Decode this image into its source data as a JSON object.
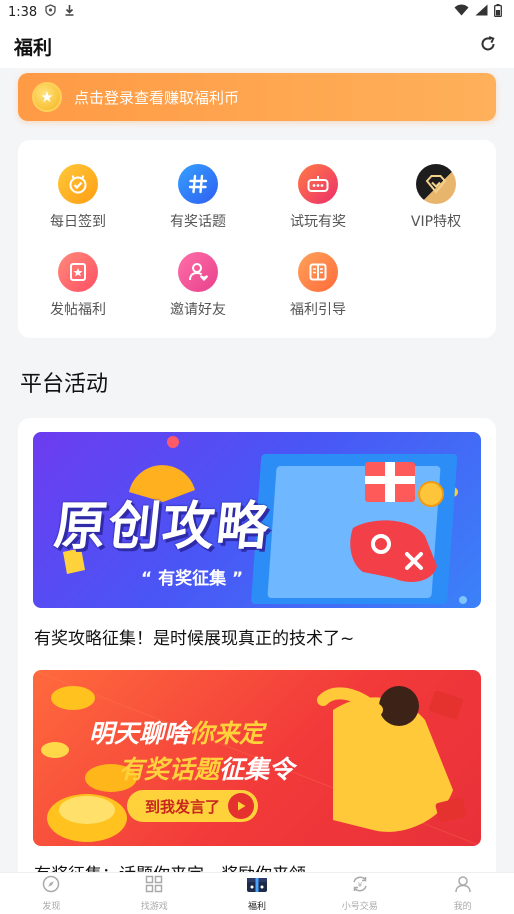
{
  "status": {
    "time": "1:38"
  },
  "header": {
    "title": "福利"
  },
  "login_banner": {
    "text": "点击登录查看赚取福利币"
  },
  "welfare_grid": [
    {
      "label": "每日签到",
      "icon": "checkin-icon",
      "color": "#ffb21d"
    },
    {
      "label": "有奖话题",
      "icon": "hashtag-icon",
      "color": "#2f7bf6"
    },
    {
      "label": "试玩有奖",
      "icon": "gamepad-icon",
      "color": "#f0525a"
    },
    {
      "label": "VIP特权",
      "icon": "vip-diamond-icon",
      "color": "#2b2b2b"
    },
    {
      "label": "发帖福利",
      "icon": "post-icon",
      "color": "#ff5d6a"
    },
    {
      "label": "邀请好友",
      "icon": "invite-friend-icon",
      "color": "#ff5b93"
    },
    {
      "label": "福利引导",
      "icon": "guide-book-icon",
      "color": "#ff7a3c"
    }
  ],
  "platform": {
    "section_title": "平台活动",
    "activities": [
      {
        "banner_title": "原创攻略",
        "banner_subtitle": "有奖征集",
        "caption": "有奖攻略征集！是时候展现真正的技术了~"
      },
      {
        "banner_line1_a": "明天聊啥",
        "banner_line1_b": "你来定",
        "banner_line2_a": "有奖话题",
        "banner_line2_b": "征集令",
        "banner_button": "到我发言了",
        "caption": "有奖征集：话题你来定，奖励你来领"
      }
    ]
  },
  "tabs": [
    {
      "label": "发现",
      "icon": "compass-icon",
      "active": false
    },
    {
      "label": "找游戏",
      "icon": "grid-icon",
      "active": false
    },
    {
      "label": "福利",
      "icon": "gift-box-icon",
      "active": true
    },
    {
      "label": "小号交易",
      "icon": "exchange-icon",
      "active": false
    },
    {
      "label": "我的",
      "icon": "user-icon",
      "active": false
    }
  ]
}
